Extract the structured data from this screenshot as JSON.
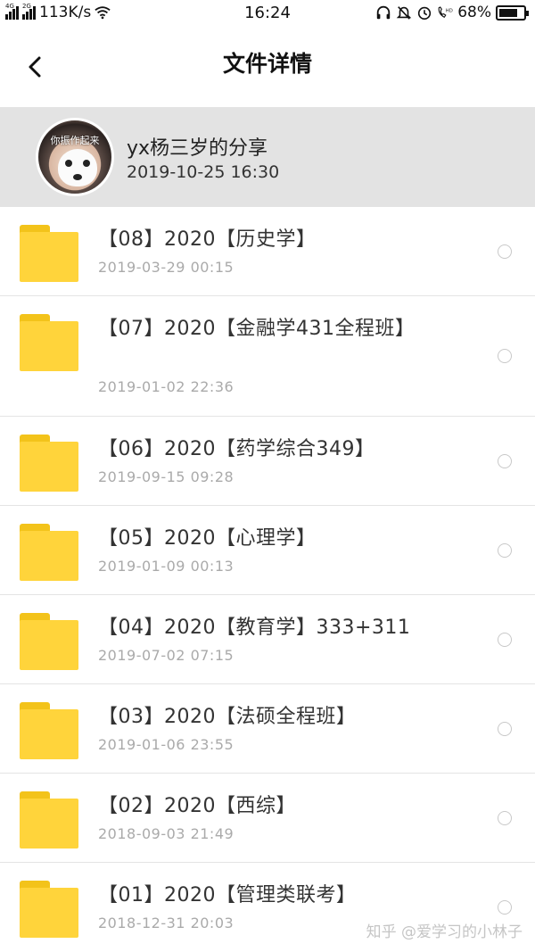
{
  "status_bar": {
    "net_tag_1": "4G",
    "net_tag_2": "2G",
    "speed": "113K/s",
    "time": "16:24",
    "battery_text": "68%",
    "battery_level": 0.68,
    "icons": [
      "signal-icon",
      "signal-icon",
      "wifi-icon",
      "headphones-icon",
      "mute-bell-icon",
      "alarm-icon",
      "hd-call-icon",
      "battery-icon"
    ]
  },
  "header": {
    "title": "文件详情",
    "back_icon": "chevron-left-icon"
  },
  "share": {
    "avatar_caption": "你振作起来",
    "name": "yx杨三岁的分享",
    "datetime": "2019-10-25  16:30"
  },
  "files": [
    {
      "name": "【08】2020【历史学】",
      "date": "2019-03-29  00:15"
    },
    {
      "name": "【07】2020【金融学431全程班】",
      "date": "2019-01-02  22:36"
    },
    {
      "name": "【06】2020【药学综合349】",
      "date": "2019-09-15  09:28"
    },
    {
      "name": "【05】2020【心理学】",
      "date": "2019-01-09  00:13"
    },
    {
      "name": "【04】2020【教育学】333+311",
      "date": "2019-07-02  07:15"
    },
    {
      "name": "【03】2020【法硕全程班】",
      "date": "2019-01-06  23:55"
    },
    {
      "name": "【02】2020【西综】",
      "date": "2018-09-03  21:49"
    },
    {
      "name": "【01】2020【管理类联考】",
      "date": "2018-12-31  20:03"
    }
  ],
  "colors": {
    "folder": "#ffd43b",
    "share_bg": "#e3e3e3"
  },
  "watermark": "知乎 @爱学习的小林子"
}
